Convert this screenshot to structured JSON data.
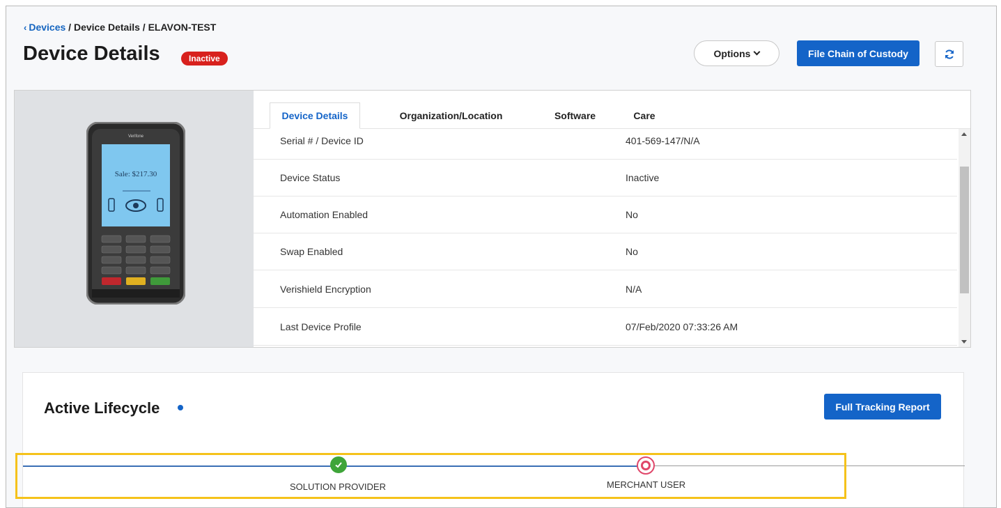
{
  "breadcrumb": {
    "link": "Devices",
    "separator1": "/",
    "current": "Device Details",
    "separator2": "/",
    "device_name": "ELAVON-TEST"
  },
  "header": {
    "title": "Device Details",
    "status_badge": "Inactive",
    "options_label": "Options",
    "custody_label": "File Chain of Custody"
  },
  "device_image": {
    "brand": "Verifone",
    "screen_text": "Sale: $217.30"
  },
  "tabs": [
    {
      "label": "Device Details",
      "active": true
    },
    {
      "label": "Organization/Location",
      "active": false
    },
    {
      "label": "Software",
      "active": false
    },
    {
      "label": "Care",
      "active": false
    }
  ],
  "details": [
    {
      "label": "Serial # / Device ID",
      "value": "401-569-147/N/A"
    },
    {
      "label": "Device Status",
      "value": "Inactive"
    },
    {
      "label": "Automation Enabled",
      "value": "No"
    },
    {
      "label": "Swap Enabled",
      "value": "No"
    },
    {
      "label": "Verishield Encryption",
      "value": "N/A"
    },
    {
      "label": "Last Device Profile",
      "value": "07/Feb/2020 07:33:26 AM"
    }
  ],
  "lifecycle": {
    "title": "Active Lifecycle",
    "tracking_label": "Full Tracking Report",
    "steps": [
      {
        "label": "SOLUTION PROVIDER",
        "state": "completed"
      },
      {
        "label": "MERCHANT USER",
        "state": "current"
      }
    ]
  },
  "colors": {
    "primary": "#1464c8",
    "badge_red": "#d8211d",
    "step_done": "#3fa53a",
    "step_current": "#e0476a",
    "highlight": "#f5c21b"
  }
}
